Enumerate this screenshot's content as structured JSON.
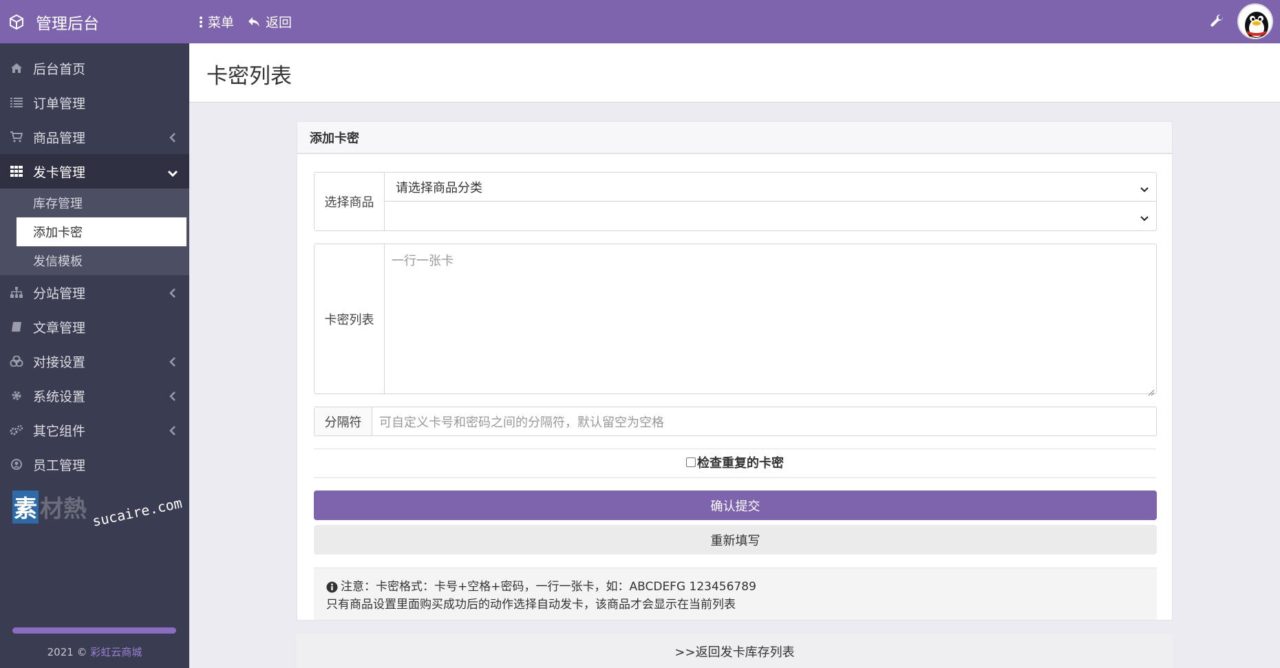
{
  "header": {
    "brand_title": "管理后台",
    "menu_label": "菜单",
    "back_label": "返回"
  },
  "sidebar": {
    "items": [
      {
        "label": "后台首页",
        "icon": "home-icon"
      },
      {
        "label": "订单管理",
        "icon": "list-icon"
      },
      {
        "label": "商品管理",
        "icon": "cart-icon"
      },
      {
        "label": "发卡管理",
        "icon": "grid-icon"
      },
      {
        "label": "分站管理",
        "icon": "sitemap-icon"
      },
      {
        "label": "文章管理",
        "icon": "book-icon"
      },
      {
        "label": "对接设置",
        "icon": "cubes-icon"
      },
      {
        "label": "系统设置",
        "icon": "gear-icon"
      },
      {
        "label": "其它组件",
        "icon": "gears-icon"
      },
      {
        "label": "员工管理",
        "icon": "user-icon"
      }
    ],
    "submenu": [
      {
        "label": "库存管理"
      },
      {
        "label": "添加卡密"
      },
      {
        "label": "发信模板"
      }
    ],
    "watermark": "素材熱 sucaire.com",
    "footer_year": "2021 ©",
    "footer_link": "彩虹云商城"
  },
  "page": {
    "title": "卡密列表"
  },
  "panel": {
    "heading": "添加卡密",
    "select_product_label": "选择商品",
    "category_select_value": "请选择商品分类",
    "product_select_value": "",
    "card_list_label": "卡密列表",
    "card_list_placeholder": "一行一张卡",
    "separator_label": "分隔符",
    "separator_placeholder": "可自定义卡号和密码之间的分隔符，默认留空为空格",
    "check_duplicate_label": "检查重复的卡密",
    "submit_label": "确认提交",
    "reset_label": "重新填写",
    "notice_line1": "注意：卡密格式：卡号+空格+密码，一行一张卡，如：ABCDEFG 123456789",
    "notice_line2": "只有商品设置里面购买成功后的动作选择自动发卡，该商品才会显示在当前列表"
  },
  "back_link": ">>返回发卡库存列表",
  "colors": {
    "accent": "#7e63ad",
    "sidebar_bg": "#3a3d52"
  }
}
